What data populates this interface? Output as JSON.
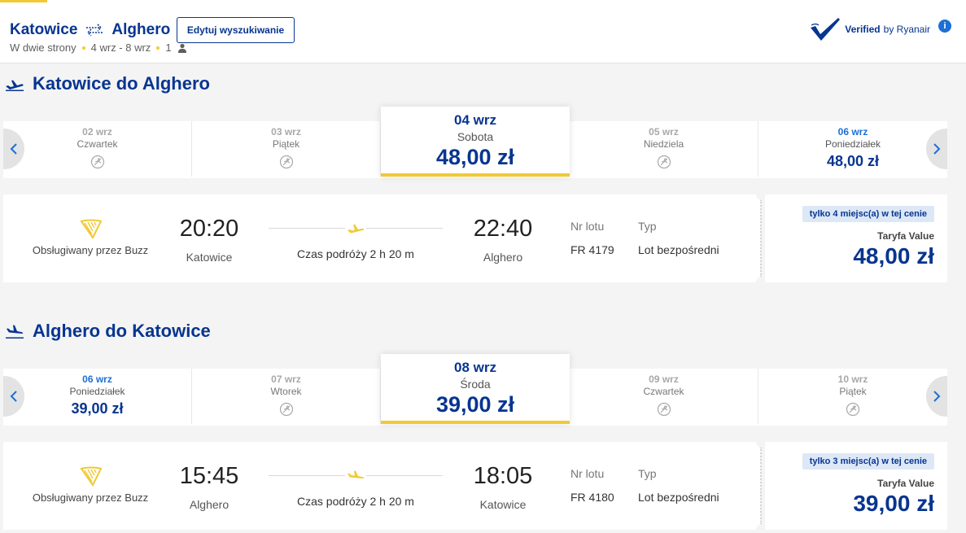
{
  "header": {
    "origin": "Katowice",
    "destination": "Alghero",
    "trip_type": "W dwie strony",
    "dates": "4 wrz - 8 wrz",
    "passengers": "1",
    "edit_label": "Edytuj wyszukiwanie",
    "verified_bold": "Verified",
    "verified_rest": "by Ryanair",
    "info": "i"
  },
  "colors": {
    "brand_blue": "#073590",
    "accent_yellow": "#f1c933",
    "link_blue": "#1c6fd6"
  },
  "outbound": {
    "title": "Katowice do Alghero",
    "dates": [
      {
        "date": "02 wrz",
        "weekday": "Czwartek",
        "price": "",
        "available": false,
        "selected": false
      },
      {
        "date": "03 wrz",
        "weekday": "Piątek",
        "price": "",
        "available": false,
        "selected": false
      },
      {
        "date": "04 wrz",
        "weekday": "Sobota",
        "price": "48,00 zł",
        "available": true,
        "selected": true
      },
      {
        "date": "05 wrz",
        "weekday": "Niedziela",
        "price": "",
        "available": false,
        "selected": false
      },
      {
        "date": "06 wrz",
        "weekday": "Poniedziałek",
        "price": "48,00 zł",
        "available": true,
        "selected": false
      }
    ],
    "flight": {
      "operator": "Obsługiwany przez Buzz",
      "dep_time": "20:20",
      "dep_city": "Katowice",
      "arr_time": "22:40",
      "arr_city": "Alghero",
      "duration": "Czas podróży 2 h 20 m",
      "flight_no_label": "Nr lotu",
      "flight_no": "FR 4179",
      "type_label": "Typ",
      "type": "Lot bezpośredni",
      "seats_badge": "tylko 4 miejsc(a) w tej cenie",
      "fare_name": "Taryfa Value",
      "fare_price": "48,00 zł"
    }
  },
  "inbound": {
    "title": "Alghero do Katowice",
    "dates": [
      {
        "date": "06 wrz",
        "weekday": "Poniedziałek",
        "price": "39,00 zł",
        "available": true,
        "selected": false
      },
      {
        "date": "07 wrz",
        "weekday": "Wtorek",
        "price": "",
        "available": false,
        "selected": false
      },
      {
        "date": "08 wrz",
        "weekday": "Środa",
        "price": "39,00 zł",
        "available": true,
        "selected": true
      },
      {
        "date": "09 wrz",
        "weekday": "Czwartek",
        "price": "",
        "available": false,
        "selected": false
      },
      {
        "date": "10 wrz",
        "weekday": "Piątek",
        "price": "",
        "available": false,
        "selected": false
      }
    ],
    "flight": {
      "operator": "Obsługiwany przez Buzz",
      "dep_time": "15:45",
      "dep_city": "Alghero",
      "arr_time": "18:05",
      "arr_city": "Katowice",
      "duration": "Czas podróży 2 h 20 m",
      "flight_no_label": "Nr lotu",
      "flight_no": "FR 4180",
      "type_label": "Typ",
      "type": "Lot bezpośredni",
      "seats_badge": "tylko 3 miejsc(a) w tej cenie",
      "fare_name": "Taryfa Value",
      "fare_price": "39,00 zł"
    }
  }
}
